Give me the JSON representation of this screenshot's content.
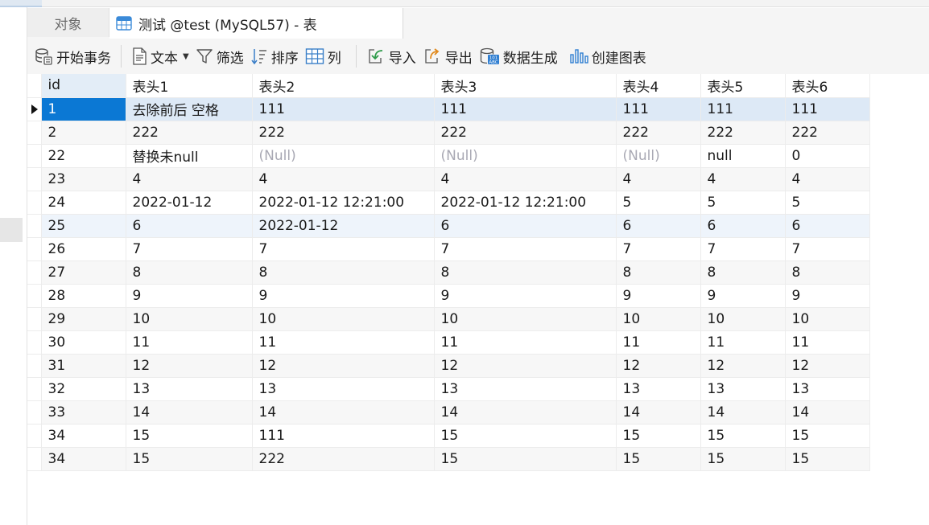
{
  "tabs": {
    "objects": "对象",
    "table_tab": "测试 @test (MySQL57) - 表"
  },
  "toolbar": {
    "begin_transaction": "开始事务",
    "text": "文本",
    "filter": "筛选",
    "sort": "排序",
    "columns": "列",
    "import": "导入",
    "export": "导出",
    "data_generation": "数据生成",
    "create_chart": "创建图表"
  },
  "icons": {
    "begin_transaction": "database-transaction-icon",
    "text": "document-text-icon",
    "filter": "funnel-filter-icon",
    "sort": "sort-icon",
    "columns": "grid-columns-icon",
    "import": "import-icon",
    "export": "export-icon",
    "data_generation": "data-generation-icon",
    "create_chart": "chart-icon"
  },
  "colors": {
    "selected_cell": "#0b78d4",
    "selected_row": "#dde9f6",
    "null_text": "#a9a9b4"
  },
  "grid": {
    "columns": [
      "id",
      "表头1",
      "表头2",
      "表头3",
      "表头4",
      "表头5",
      "表头6"
    ],
    "selected_row": 0,
    "rows": [
      [
        "1",
        "去除前后 空格",
        "111",
        "111",
        "111",
        "111",
        "111"
      ],
      [
        "2",
        "222",
        "222",
        "222",
        "222",
        "222",
        "222"
      ],
      [
        "22",
        "替换未null",
        "(Null)",
        "(Null)",
        "(Null)",
        "null",
        "0"
      ],
      [
        "23",
        "4",
        "4",
        "4",
        "4",
        "4",
        "4"
      ],
      [
        "24",
        "2022-01-12",
        "2022-01-12 12:21:00",
        "2022-01-12 12:21:00",
        "5",
        "5",
        "5"
      ],
      [
        "25",
        "6",
        "2022-01-12",
        "6",
        "6",
        "6",
        "6"
      ],
      [
        "26",
        "7",
        "7",
        "7",
        "7",
        "7",
        "7"
      ],
      [
        "27",
        "8",
        "8",
        "8",
        "8",
        "8",
        "8"
      ],
      [
        "28",
        "9",
        "9",
        "9",
        "9",
        "9",
        "9"
      ],
      [
        "29",
        "10",
        "10",
        "10",
        "10",
        "10",
        "10"
      ],
      [
        "30",
        "11",
        "11",
        "11",
        "11",
        "11",
        "11"
      ],
      [
        "31",
        "12",
        "12",
        "12",
        "12",
        "12",
        "12"
      ],
      [
        "32",
        "13",
        "13",
        "13",
        "13",
        "13",
        "13"
      ],
      [
        "33",
        "14",
        "14",
        "14",
        "14",
        "14",
        "14"
      ],
      [
        "34",
        "15",
        "111",
        "15",
        "15",
        "15",
        "15"
      ],
      [
        "34",
        "15",
        "222",
        "15",
        "15",
        "15",
        "15"
      ]
    ]
  }
}
